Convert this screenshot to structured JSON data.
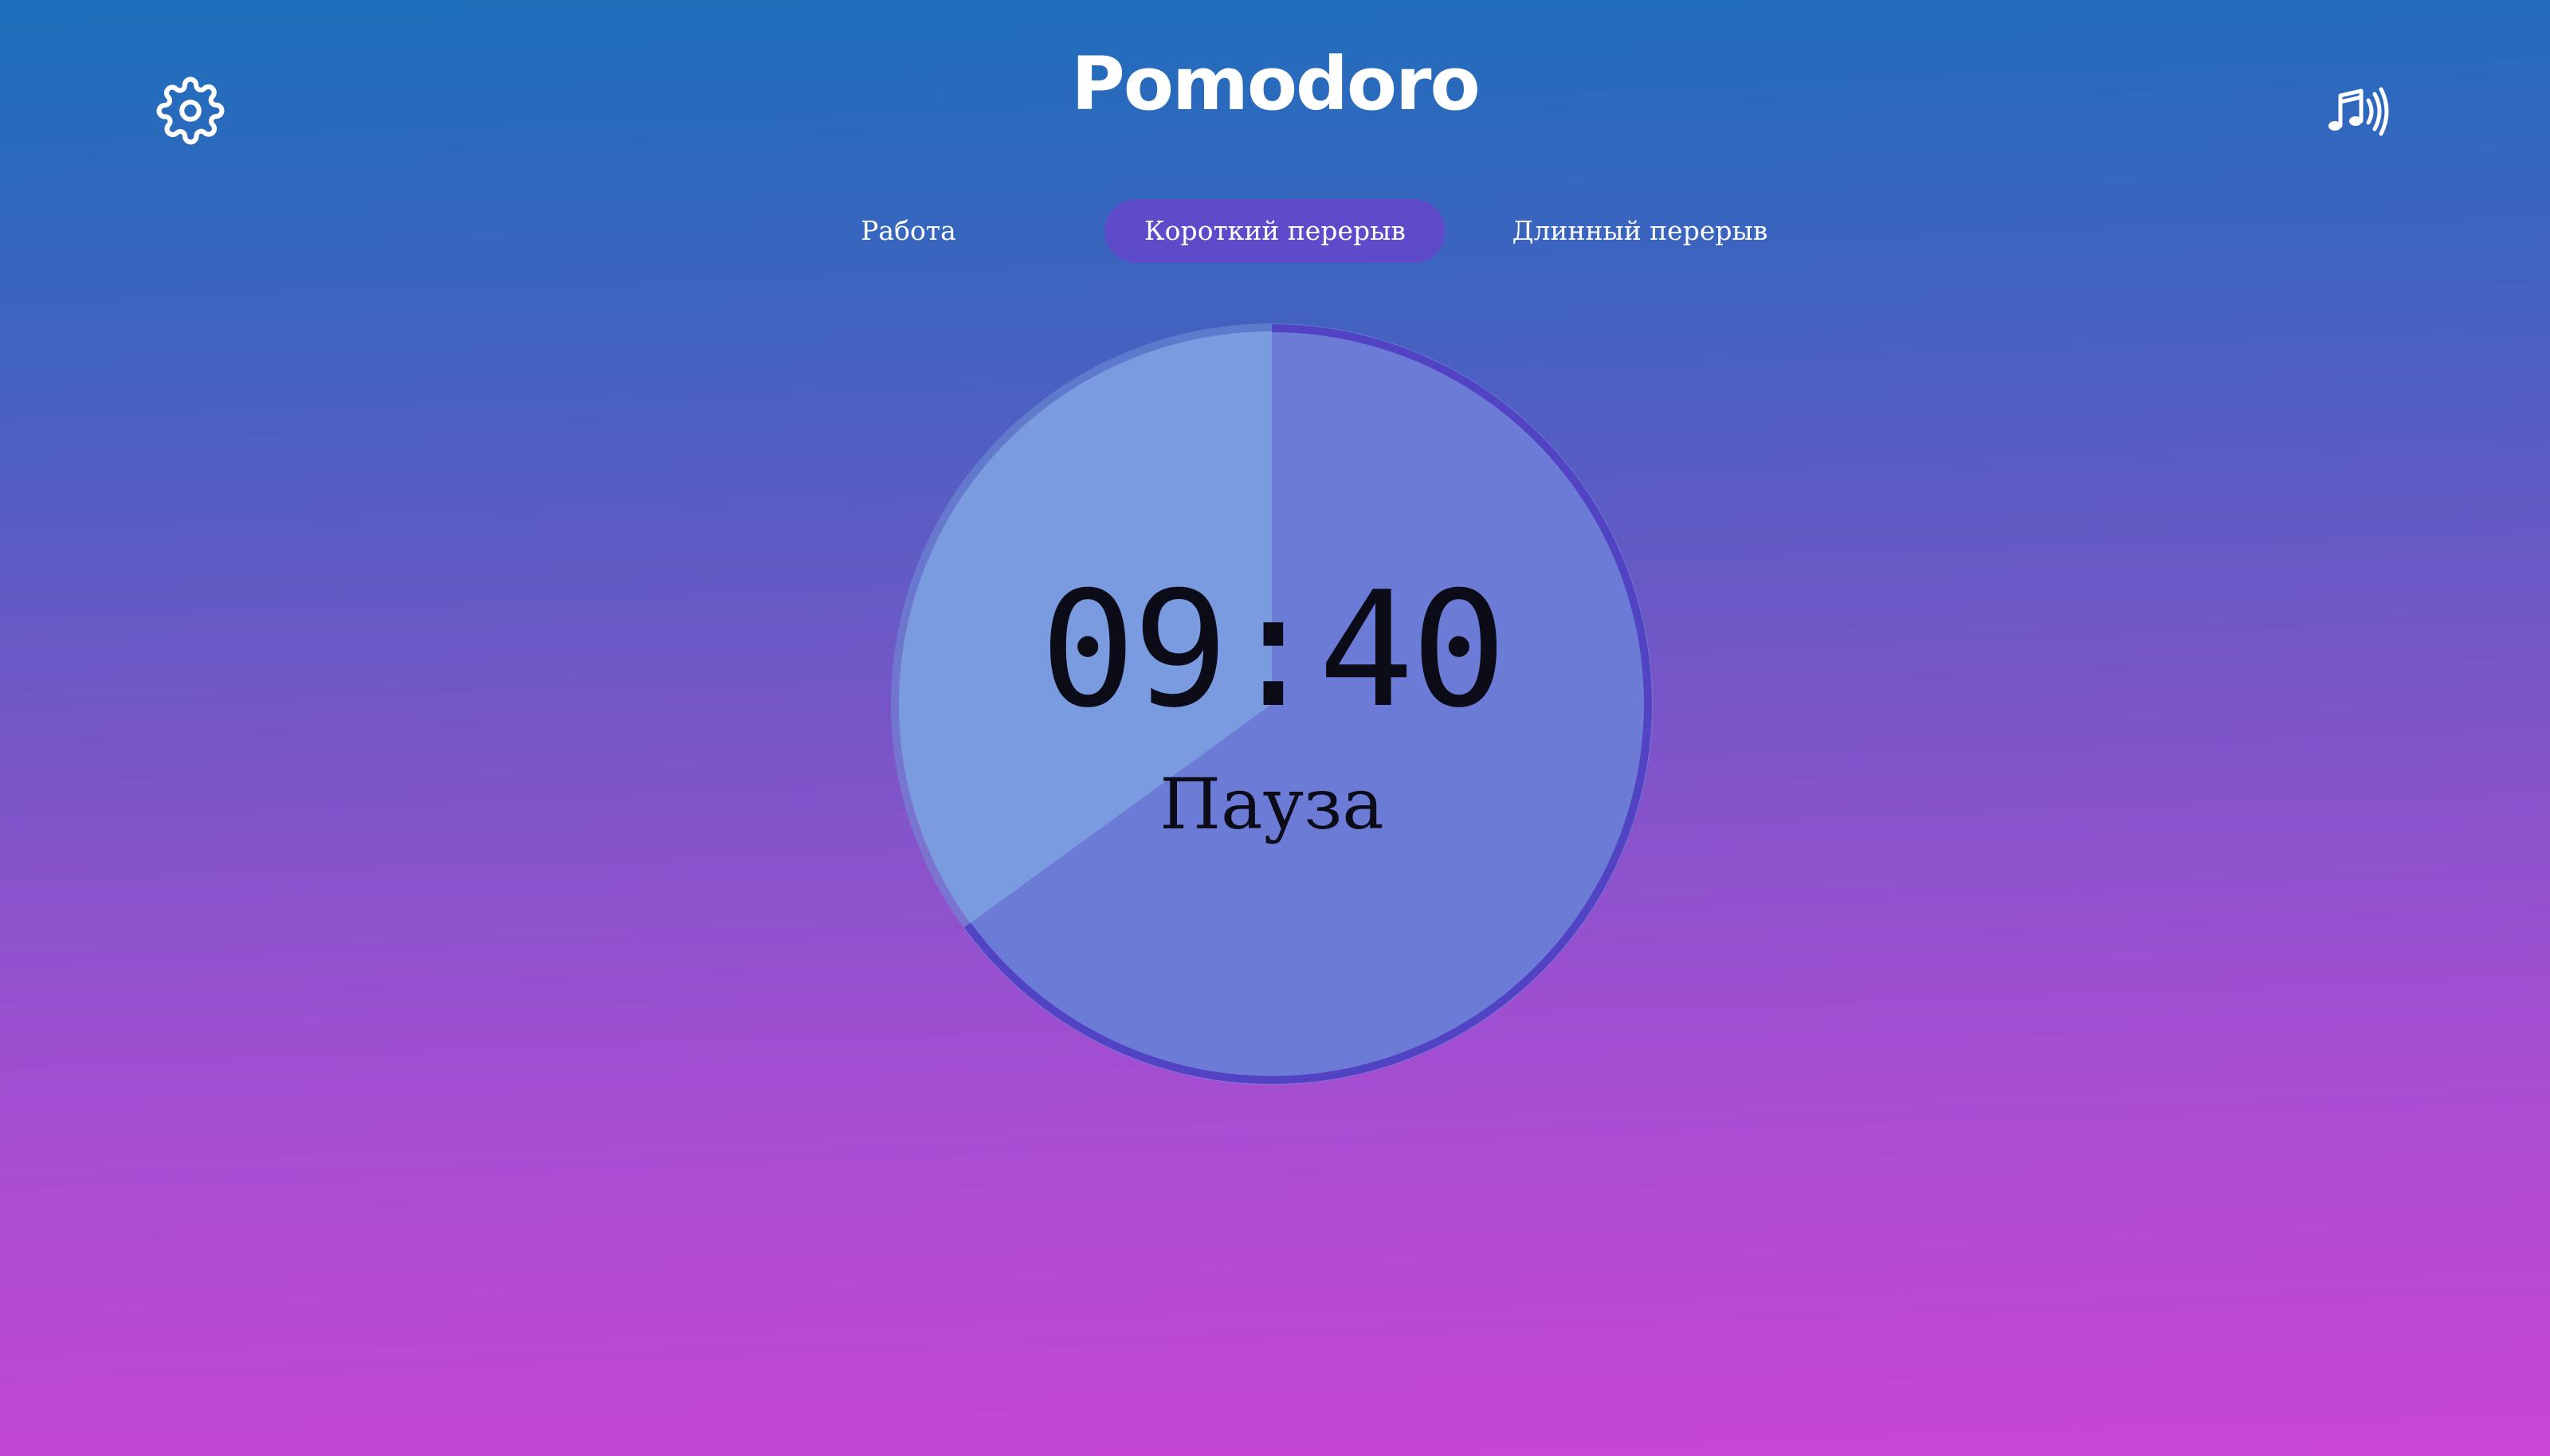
{
  "app": {
    "title": "Pomodoro"
  },
  "icons": {
    "settings": "gear-icon",
    "sound": "music-sound-icon"
  },
  "tabs": [
    {
      "label": "Работа",
      "active": false
    },
    {
      "label": "Короткий перерыв",
      "active": true
    },
    {
      "label": "Длинный перерыв",
      "active": false
    }
  ],
  "timer": {
    "time": "09:40",
    "status": "Пауза",
    "elapsed_fraction": 0.35
  },
  "colors": {
    "accent": "#5d4bc9",
    "gradient_top": "#1b6fba",
    "gradient_bottom": "#c945d6"
  }
}
